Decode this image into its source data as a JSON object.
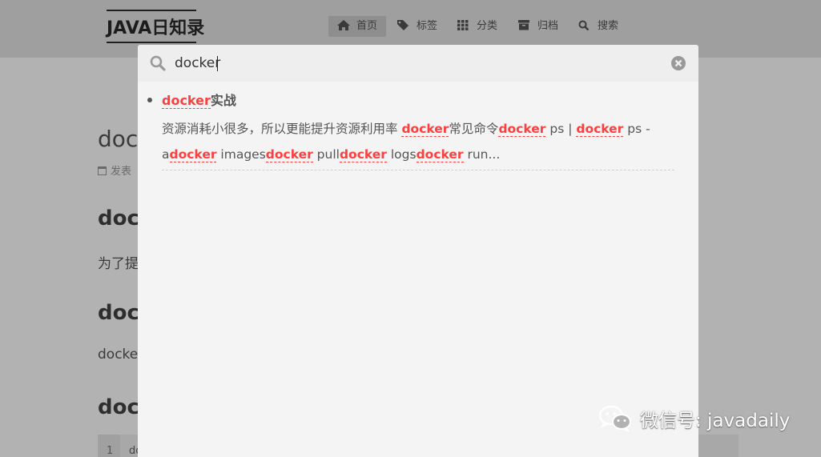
{
  "header": {
    "brand": "JAVA日知录",
    "nav": [
      {
        "label": "首页",
        "icon": "home-icon",
        "active": true
      },
      {
        "label": "标签",
        "icon": "tag-icon",
        "active": false
      },
      {
        "label": "分类",
        "icon": "grid-icon",
        "active": false
      },
      {
        "label": "归档",
        "icon": "archive-icon",
        "active": false
      },
      {
        "label": "搜索",
        "icon": "search-icon",
        "active": false
      }
    ]
  },
  "background_page": {
    "title_fragment": "doc",
    "meta_fragment": "发表",
    "heading1_fragment": "dock",
    "para1_fragment": "为了提",
    "heading2_fragment": "dock",
    "para2_fragment": "docke",
    "heading3_fragment": "dock",
    "code_line_number": "1",
    "code_fragment": "do"
  },
  "search": {
    "query": "docker",
    "result": {
      "title_highlight": "docker",
      "title_rest": "实战",
      "snippet_parts": [
        {
          "text": "资源消耗小很多，所以更能提升资源利用率 ",
          "hl": false
        },
        {
          "text": "docker",
          "hl": true
        },
        {
          "text": "常见命令",
          "hl": false
        },
        {
          "text": "docker",
          "hl": true
        },
        {
          "text": " ps | ",
          "hl": false
        },
        {
          "text": "docker",
          "hl": true
        },
        {
          "text": " ps -a",
          "hl": false
        },
        {
          "text": "docker",
          "hl": true
        },
        {
          "text": " images",
          "hl": false
        },
        {
          "text": "docker",
          "hl": true
        },
        {
          "text": " pull",
          "hl": false
        },
        {
          "text": "docker",
          "hl": true
        },
        {
          "text": " logs",
          "hl": false
        },
        {
          "text": "docker",
          "hl": true
        },
        {
          "text": " run...",
          "hl": false
        }
      ]
    }
  },
  "watermark": {
    "text": "微信号: javadaily"
  },
  "colors": {
    "highlight": "#fc3f3f",
    "overlay": "#b2b2b2",
    "popup": "#f4f4f4"
  }
}
